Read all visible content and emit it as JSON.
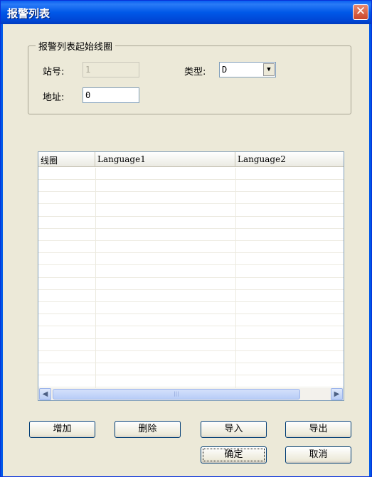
{
  "window": {
    "title": "报警列表",
    "close_label": "✕"
  },
  "group": {
    "title": "报警列表起始线圈",
    "station_label": "站号:",
    "station_value": "1",
    "type_label": "类型:",
    "type_value": "D",
    "address_label": "地址:",
    "address_value": "0"
  },
  "table": {
    "columns": [
      "线圈",
      "Language1",
      "Language2"
    ],
    "row_count": 18
  },
  "scrollbar": {
    "left": "◀",
    "right": "▶",
    "thumb": "|||"
  },
  "buttons": {
    "add": "增加",
    "delete": "删除",
    "import": "导入",
    "export": "导出",
    "ok": "确定",
    "cancel": "取消"
  }
}
